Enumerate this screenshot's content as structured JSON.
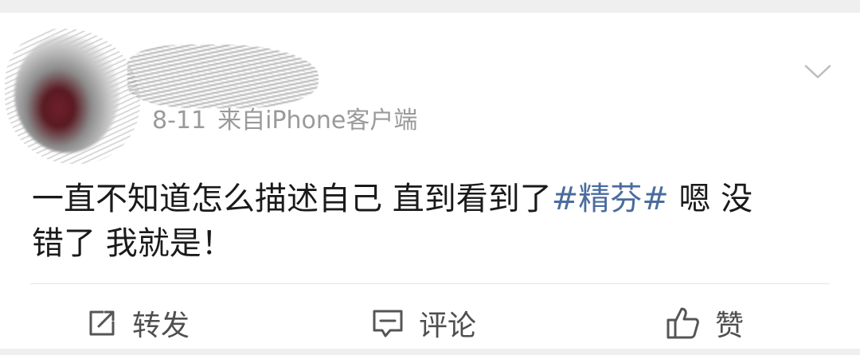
{
  "post": {
    "timestamp": "8-11",
    "source": "来自iPhone客户端",
    "text_line1_before": "一直不知道怎么描述自己 直到看到了",
    "hashtag": "#精芬#",
    "text_line1_after": " 嗯 没",
    "text_line2": "错了 我就是！"
  },
  "actions": {
    "repost_label": "转发",
    "comment_label": "评论",
    "like_label": "赞"
  },
  "icons": {
    "repost": "share-icon",
    "comment": "comment-icon",
    "like": "thumbs-up-icon",
    "more": "chevron-down-icon"
  },
  "colors": {
    "hashtag": "#4a6c9e",
    "meta_text": "#9a9a9a",
    "body_text": "#1a1a1a",
    "action_text": "#4f4f4f"
  }
}
